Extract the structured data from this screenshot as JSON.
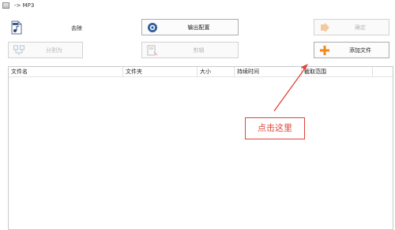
{
  "window": {
    "title": "-> MP3"
  },
  "toolbar": {
    "remove_label": "去除",
    "output_settings_label": "输出配置",
    "confirm_label": "确定",
    "split_label": "分割为",
    "edit_label": "剪辑",
    "add_file_label": "添加文件"
  },
  "file_list": {
    "columns": [
      "文件名",
      "文件夹",
      "大小",
      "持续时间",
      "截取范围"
    ],
    "rows": []
  },
  "annotation": {
    "callout_text": "点击这里",
    "color": "#e0443a"
  },
  "colors": {
    "add_icon": "#f08a1c",
    "disabled_text": "#b5b5b5"
  },
  "icons": {
    "app": "app-icon",
    "remove": "music-file-icon",
    "output_settings": "settings-icon",
    "confirm": "arrow-right-icon",
    "split": "split-icon",
    "edit": "film-edit-icon",
    "add_file": "plus-icon"
  }
}
